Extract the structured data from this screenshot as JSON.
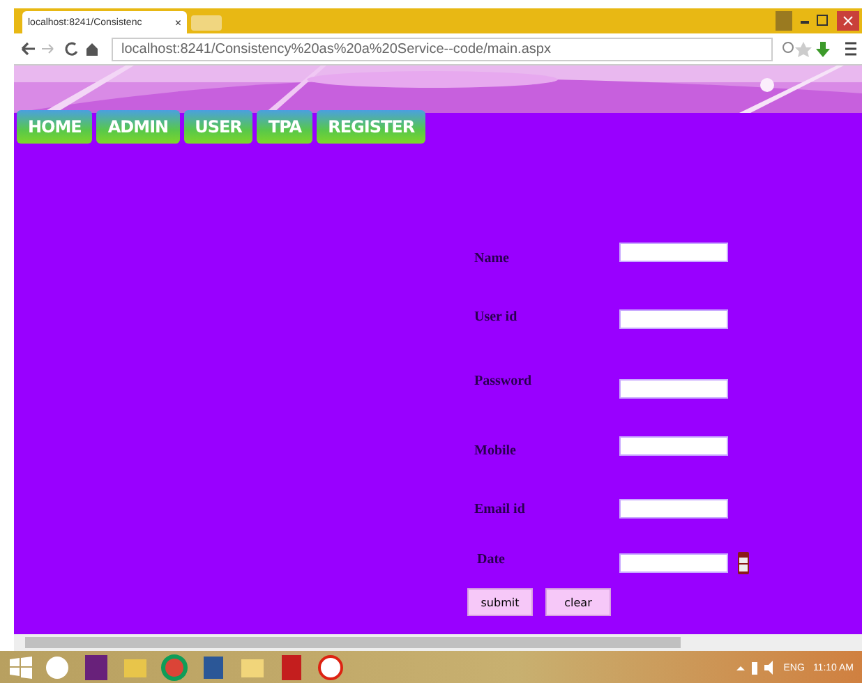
{
  "browser": {
    "tab_title": "localhost:8241/Consistenc",
    "tab_close": "×",
    "url": "localhost:8241/Consistency%20as%20a%20Service--code/main.aspx"
  },
  "nav": [
    {
      "label": "HOME"
    },
    {
      "label": "ADMIN"
    },
    {
      "label": "USER"
    },
    {
      "label": "TPA"
    },
    {
      "label": "REGISTER"
    }
  ],
  "form": {
    "fields": [
      {
        "label": "Name",
        "kind": "text"
      },
      {
        "label": "User id",
        "kind": "text"
      },
      {
        "label": "Password",
        "kind": "text"
      },
      {
        "label": "Mobile",
        "kind": "text"
      },
      {
        "label": "Email id",
        "kind": "text"
      },
      {
        "label": "Date",
        "kind": "date"
      }
    ],
    "buttons": [
      "submit",
      "clear"
    ]
  },
  "taskbar": {
    "language": "ENG",
    "time": "11:10 AM"
  }
}
